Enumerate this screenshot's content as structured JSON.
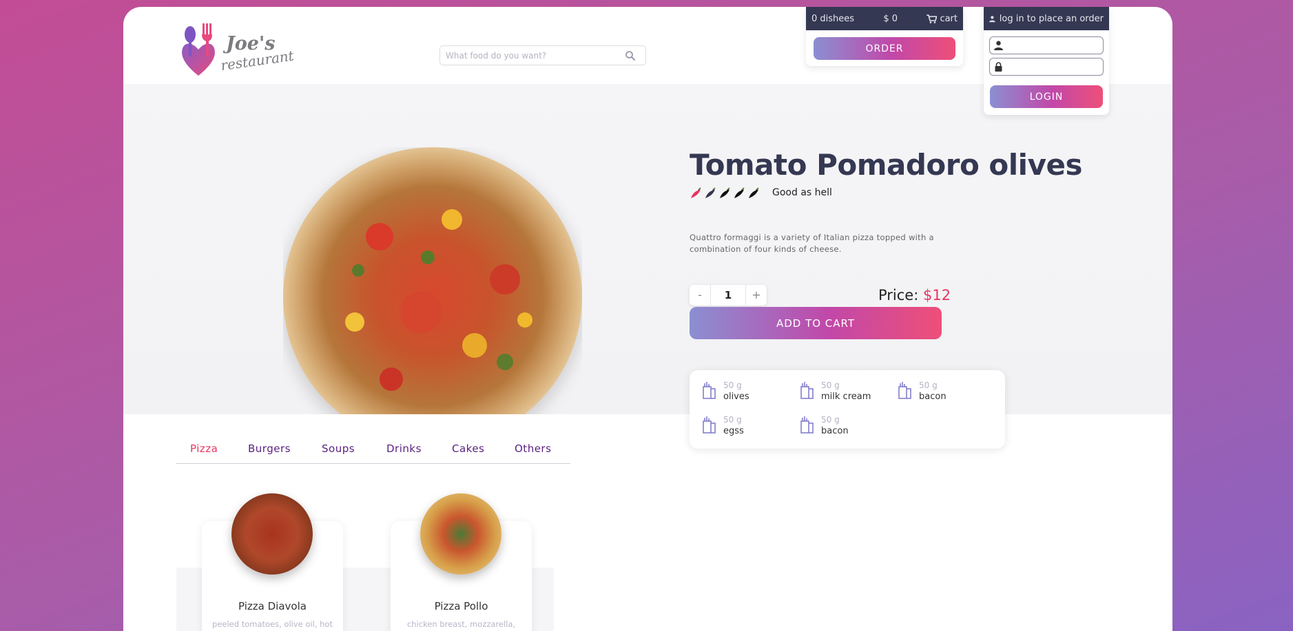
{
  "logo": {
    "title": "Joe's",
    "subtitle": "restaurant"
  },
  "search": {
    "placeholder": "What food do you want?",
    "icon": "search-icon"
  },
  "cart": {
    "dishes": "0 dishees",
    "total": "$ 0",
    "cart_label": "cart",
    "order_label": "ORDER"
  },
  "login": {
    "prompt": "log in to place an order",
    "username_value": "",
    "password_value": "",
    "button_label": "LOGIN"
  },
  "product": {
    "title": "Tomato Pomadoro olives",
    "spice_level": 1,
    "spice_max": 5,
    "spice_label": "Good as hell",
    "description": "Quattro formaggi is a variety of Italian pizza topped with a combination of four kinds of cheese.",
    "quantity": "1",
    "qty_minus": "-",
    "qty_plus": "+",
    "price_label": "Price:",
    "price_value": "$12",
    "add_to_cart": "ADD TO CART",
    "ingredients": [
      {
        "amount": "50 g",
        "name": "olives"
      },
      {
        "amount": "50 g",
        "name": "milk cream"
      },
      {
        "amount": "50 g",
        "name": "bacon"
      },
      {
        "amount": "50 g",
        "name": "egss"
      },
      {
        "amount": "50 g",
        "name": "bacon"
      }
    ]
  },
  "tabs": [
    {
      "label": "Pizza",
      "active": true
    },
    {
      "label": "Burgers",
      "active": false
    },
    {
      "label": "Soups",
      "active": false
    },
    {
      "label": "Drinks",
      "active": false
    },
    {
      "label": "Cakes",
      "active": false
    },
    {
      "label": "Others",
      "active": false
    }
  ],
  "menu": [
    {
      "name": "Pizza Diavola",
      "description": "peeled tomatoes, olive oil, hot salami, pickled jalapeń, sliced"
    },
    {
      "name": "Pizza Pollo",
      "description": "chicken breast, mozzarella, Pizza dough, garlic clove, tomato sauce,"
    }
  ],
  "colors": {
    "accent": "#e8355f",
    "dark_bar": "#353852",
    "tab_text": "#5a1f7f",
    "gradient_start": "#8b8fd3",
    "gradient_end": "#ee4f78"
  }
}
